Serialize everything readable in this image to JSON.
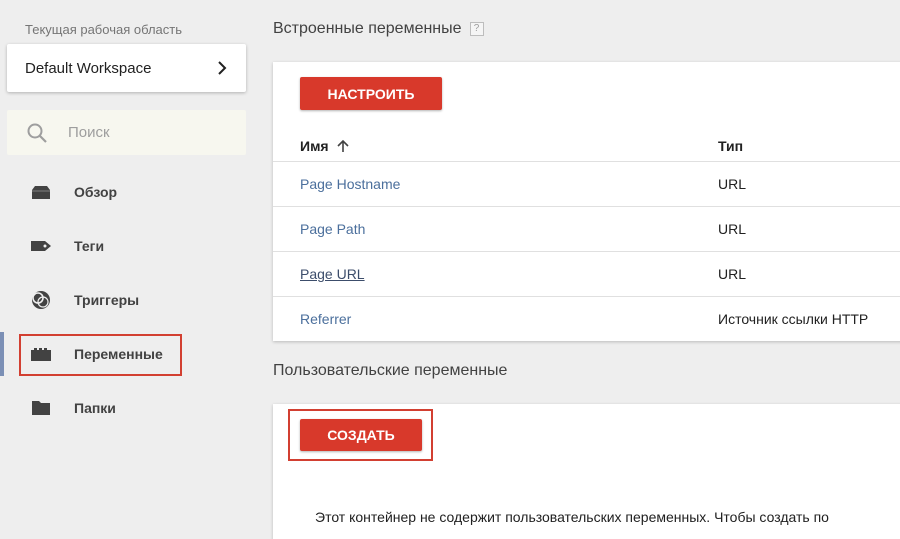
{
  "sidebar": {
    "workspace_label": "Текущая рабочая область",
    "workspace_name": "Default Workspace",
    "search_placeholder": "Поиск",
    "items": [
      {
        "label": "Обзор",
        "icon": "briefcase-icon"
      },
      {
        "label": "Теги",
        "icon": "tag-icon"
      },
      {
        "label": "Триггеры",
        "icon": "trigger-icon"
      },
      {
        "label": "Переменные",
        "icon": "variables-icon",
        "active": true
      },
      {
        "label": "Папки",
        "icon": "folder-icon"
      }
    ]
  },
  "builtin": {
    "title": "Встроенные переменные",
    "help": "?",
    "configure_label": "НАСТРОИТЬ",
    "col_name": "Имя",
    "col_type": "Тип",
    "rows": [
      {
        "name": "Page Hostname",
        "type": "URL"
      },
      {
        "name": "Page Path",
        "type": "URL"
      },
      {
        "name": "Page URL",
        "type": "URL"
      },
      {
        "name": "Referrer",
        "type": "Источник ссылки HTTP"
      }
    ]
  },
  "custom": {
    "title": "Пользовательские переменные",
    "create_label": "СОЗДАТЬ",
    "empty_message": "Этот контейнер не содержит пользовательских переменных. Чтобы создать по"
  },
  "colors": {
    "accent_red": "#d8392b",
    "link_blue": "#4b6f9c",
    "highlight": "#d23f31"
  }
}
